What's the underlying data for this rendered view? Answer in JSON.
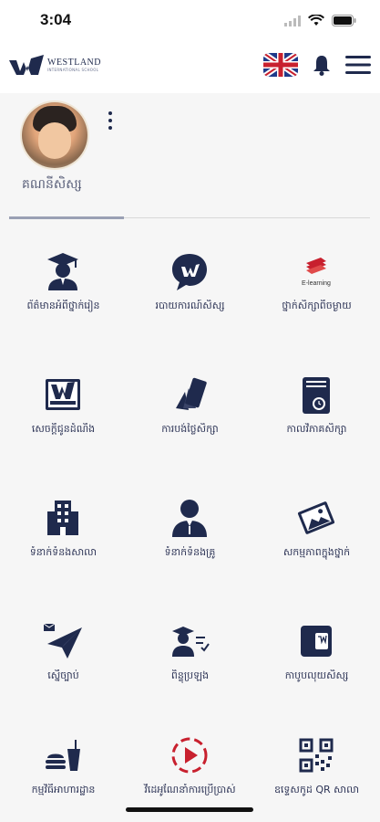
{
  "status": {
    "time": "3:04"
  },
  "brand": {
    "name": "WESTLAND",
    "subtitle": "INTERNATIONAL SCHOOL"
  },
  "profile": {
    "name": "គណនីសិស្ស"
  },
  "menu": [
    {
      "label": "ព័ត៌មានអំពីថ្នាក់រៀន",
      "icon": "graduate-icon"
    },
    {
      "label": "របាយការណ៍សិស្ស",
      "icon": "chat-logo-icon"
    },
    {
      "label": "ថ្នាក់សិក្សាពីចម្ងាយ",
      "icon": "e-learning-icon",
      "badge": "E-learning"
    },
    {
      "label": "សេចក្តីជូនដំណឹង",
      "icon": "school-logo-icon"
    },
    {
      "label": "ការបង់ថ្លៃសិក្សា",
      "icon": "payment-cards-icon"
    },
    {
      "label": "កាលវិភាគសិក្សា",
      "icon": "schedule-book-icon"
    },
    {
      "label": "ទំនាក់ទំនងសាលា",
      "icon": "building-icon"
    },
    {
      "label": "ទំនាក់ទំនងគ្រូ",
      "icon": "teacher-icon"
    },
    {
      "label": "សកម្មភាពក្នុងថ្នាក់",
      "icon": "photo-icon"
    },
    {
      "label": "ស្នើច្បាប់",
      "icon": "send-icon"
    },
    {
      "label": "ពិន្ទុប្រឡង",
      "icon": "exam-score-icon"
    },
    {
      "label": "កាបូបលុយសិស្ស",
      "icon": "wallet-icon"
    },
    {
      "label": "កម្មវិធីអាហារដ្ឋាន",
      "icon": "canteen-icon"
    },
    {
      "label": "វីដេអូណែនាំការប្រើប្រាស់",
      "icon": "video-play-icon"
    },
    {
      "label": "ឧទ្ទេសកូដ QR សាលា",
      "icon": "qr-code-icon"
    }
  ],
  "colors": {
    "navy": "#1f2a4d",
    "red": "#c8202e"
  }
}
